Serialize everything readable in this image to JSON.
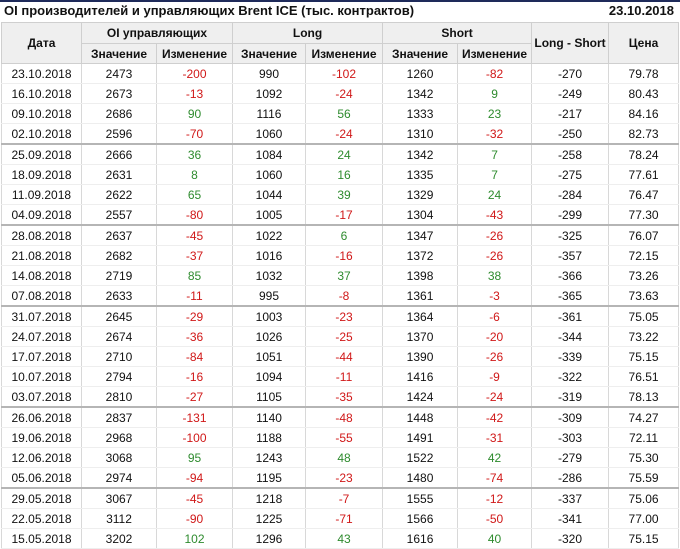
{
  "header": {
    "title": "OI производителей и управляющих Brent ICE (тыс. контрактов)",
    "date": "23.10.2018"
  },
  "columns": {
    "date": "Дата",
    "oi": "OI управляющих",
    "long": "Long",
    "short": "Short",
    "long_short": "Long - Short",
    "price": "Цена",
    "value": "Значение",
    "change": "Изменение"
  },
  "colors": {
    "positive": "#2e8b2e",
    "negative": "#d01818"
  },
  "rows": [
    {
      "date": "23.10.2018",
      "oi_value": "2473",
      "oi_change": "-200",
      "long_value": "990",
      "long_change": "-102",
      "short_value": "1260",
      "short_change": "-82",
      "long_short": "-270",
      "price": "79.78",
      "sep": false
    },
    {
      "date": "16.10.2018",
      "oi_value": "2673",
      "oi_change": "-13",
      "long_value": "1092",
      "long_change": "-24",
      "short_value": "1342",
      "short_change": "9",
      "long_short": "-249",
      "price": "80.43",
      "sep": false
    },
    {
      "date": "09.10.2018",
      "oi_value": "2686",
      "oi_change": "90",
      "long_value": "1116",
      "long_change": "56",
      "short_value": "1333",
      "short_change": "23",
      "long_short": "-217",
      "price": "84.16",
      "sep": false
    },
    {
      "date": "02.10.2018",
      "oi_value": "2596",
      "oi_change": "-70",
      "long_value": "1060",
      "long_change": "-24",
      "short_value": "1310",
      "short_change": "-32",
      "long_short": "-250",
      "price": "82.73",
      "sep": false
    },
    {
      "date": "25.09.2018",
      "oi_value": "2666",
      "oi_change": "36",
      "long_value": "1084",
      "long_change": "24",
      "short_value": "1342",
      "short_change": "7",
      "long_short": "-258",
      "price": "78.24",
      "sep": true
    },
    {
      "date": "18.09.2018",
      "oi_value": "2631",
      "oi_change": "8",
      "long_value": "1060",
      "long_change": "16",
      "short_value": "1335",
      "short_change": "7",
      "long_short": "-275",
      "price": "77.61",
      "sep": false
    },
    {
      "date": "11.09.2018",
      "oi_value": "2622",
      "oi_change": "65",
      "long_value": "1044",
      "long_change": "39",
      "short_value": "1329",
      "short_change": "24",
      "long_short": "-284",
      "price": "76.47",
      "sep": false
    },
    {
      "date": "04.09.2018",
      "oi_value": "2557",
      "oi_change": "-80",
      "long_value": "1005",
      "long_change": "-17",
      "short_value": "1304",
      "short_change": "-43",
      "long_short": "-299",
      "price": "77.30",
      "sep": false
    },
    {
      "date": "28.08.2018",
      "oi_value": "2637",
      "oi_change": "-45",
      "long_value": "1022",
      "long_change": "6",
      "short_value": "1347",
      "short_change": "-26",
      "long_short": "-325",
      "price": "76.07",
      "sep": true
    },
    {
      "date": "21.08.2018",
      "oi_value": "2682",
      "oi_change": "-37",
      "long_value": "1016",
      "long_change": "-16",
      "short_value": "1372",
      "short_change": "-26",
      "long_short": "-357",
      "price": "72.15",
      "sep": false
    },
    {
      "date": "14.08.2018",
      "oi_value": "2719",
      "oi_change": "85",
      "long_value": "1032",
      "long_change": "37",
      "short_value": "1398",
      "short_change": "38",
      "long_short": "-366",
      "price": "73.26",
      "sep": false
    },
    {
      "date": "07.08.2018",
      "oi_value": "2633",
      "oi_change": "-11",
      "long_value": "995",
      "long_change": "-8",
      "short_value": "1361",
      "short_change": "-3",
      "long_short": "-365",
      "price": "73.63",
      "sep": false
    },
    {
      "date": "31.07.2018",
      "oi_value": "2645",
      "oi_change": "-29",
      "long_value": "1003",
      "long_change": "-23",
      "short_value": "1364",
      "short_change": "-6",
      "long_short": "-361",
      "price": "75.05",
      "sep": true
    },
    {
      "date": "24.07.2018",
      "oi_value": "2674",
      "oi_change": "-36",
      "long_value": "1026",
      "long_change": "-25",
      "short_value": "1370",
      "short_change": "-20",
      "long_short": "-344",
      "price": "73.22",
      "sep": false
    },
    {
      "date": "17.07.2018",
      "oi_value": "2710",
      "oi_change": "-84",
      "long_value": "1051",
      "long_change": "-44",
      "short_value": "1390",
      "short_change": "-26",
      "long_short": "-339",
      "price": "75.15",
      "sep": false
    },
    {
      "date": "10.07.2018",
      "oi_value": "2794",
      "oi_change": "-16",
      "long_value": "1094",
      "long_change": "-11",
      "short_value": "1416",
      "short_change": "-9",
      "long_short": "-322",
      "price": "76.51",
      "sep": false
    },
    {
      "date": "03.07.2018",
      "oi_value": "2810",
      "oi_change": "-27",
      "long_value": "1105",
      "long_change": "-35",
      "short_value": "1424",
      "short_change": "-24",
      "long_short": "-319",
      "price": "78.13",
      "sep": false
    },
    {
      "date": "26.06.2018",
      "oi_value": "2837",
      "oi_change": "-131",
      "long_value": "1140",
      "long_change": "-48",
      "short_value": "1448",
      "short_change": "-42",
      "long_short": "-309",
      "price": "74.27",
      "sep": true
    },
    {
      "date": "19.06.2018",
      "oi_value": "2968",
      "oi_change": "-100",
      "long_value": "1188",
      "long_change": "-55",
      "short_value": "1491",
      "short_change": "-31",
      "long_short": "-303",
      "price": "72.11",
      "sep": false
    },
    {
      "date": "12.06.2018",
      "oi_value": "3068",
      "oi_change": "95",
      "long_value": "1243",
      "long_change": "48",
      "short_value": "1522",
      "short_change": "42",
      "long_short": "-279",
      "price": "75.30",
      "sep": false
    },
    {
      "date": "05.06.2018",
      "oi_value": "2974",
      "oi_change": "-94",
      "long_value": "1195",
      "long_change": "-23",
      "short_value": "1480",
      "short_change": "-74",
      "long_short": "-286",
      "price": "75.59",
      "sep": false
    },
    {
      "date": "29.05.2018",
      "oi_value": "3067",
      "oi_change": "-45",
      "long_value": "1218",
      "long_change": "-7",
      "short_value": "1555",
      "short_change": "-12",
      "long_short": "-337",
      "price": "75.06",
      "sep": true
    },
    {
      "date": "22.05.2018",
      "oi_value": "3112",
      "oi_change": "-90",
      "long_value": "1225",
      "long_change": "-71",
      "short_value": "1566",
      "short_change": "-50",
      "long_short": "-341",
      "price": "77.00",
      "sep": false
    },
    {
      "date": "15.05.2018",
      "oi_value": "3202",
      "oi_change": "102",
      "long_value": "1296",
      "long_change": "43",
      "short_value": "1616",
      "short_change": "40",
      "long_short": "-320",
      "price": "75.15",
      "sep": false
    }
  ]
}
